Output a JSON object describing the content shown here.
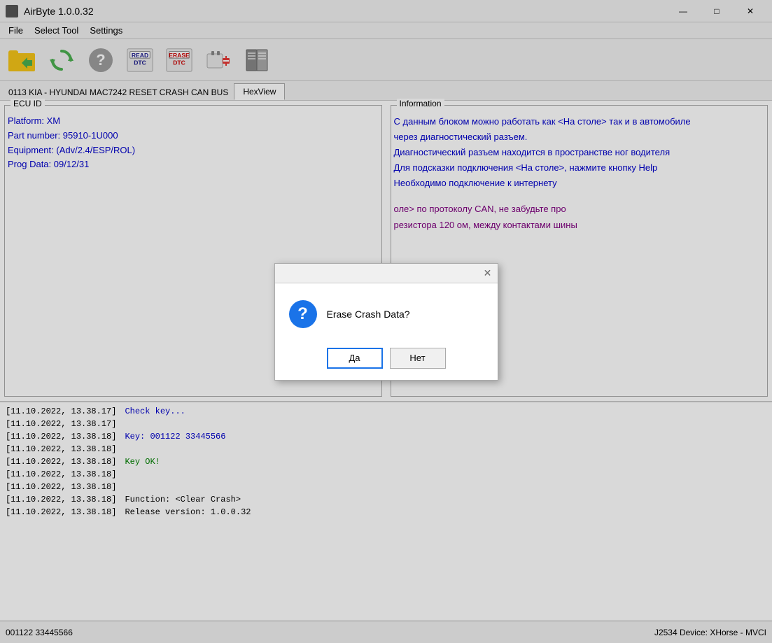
{
  "window": {
    "title": "AirByte  1.0.0.32",
    "controls": {
      "minimize": "—",
      "maximize": "□",
      "close": "✕"
    }
  },
  "menu": {
    "items": [
      "File",
      "Select Tool",
      "Settings"
    ]
  },
  "toolbar": {
    "buttons": [
      {
        "name": "open-file",
        "icon": "folder",
        "label": ""
      },
      {
        "name": "refresh",
        "icon": "refresh",
        "label": ""
      },
      {
        "name": "help",
        "icon": "help",
        "label": ""
      },
      {
        "name": "read-dtc",
        "icon": "read-dtc",
        "label": "READ\nDTC"
      },
      {
        "name": "erase-dtc",
        "icon": "erase-dtc",
        "label": "ERASE\nDTC"
      },
      {
        "name": "plugin",
        "icon": "plugin",
        "label": ""
      },
      {
        "name": "book",
        "icon": "book",
        "label": ""
      }
    ]
  },
  "tabs": {
    "main_label": "0113 KIA - HYUNDAI MAC7242 RESET CRASH CAN BUS",
    "items": [
      {
        "id": "hexview",
        "label": "HexView",
        "active": true
      }
    ]
  },
  "ecu_id": {
    "title": "ECU ID",
    "platform": "Platform: XM",
    "part_number": "Part number: 95910-1U000",
    "equipment": "Equipment: (Adv/2.4/ESP/ROL)",
    "prog_data": "Prog Data: 09/12/31"
  },
  "information": {
    "title": "Information",
    "lines": [
      {
        "text": "С данным блоком можно работать как <На столе> так и в автомобиле через диагностический разъем.",
        "color": "blue"
      },
      {
        "text": "Диагностический разъем находится в пространстве ног водителя",
        "color": "blue"
      },
      {
        "text": "Для подсказки подключения <На столе>, нажмите кнопку Help",
        "color": "blue"
      },
      {
        "text": "Необходимо подключение к интернету",
        "color": "blue"
      },
      {
        "text": "",
        "color": "blue"
      },
      {
        "text": "оле> по протоколу CAN, не забудьте про резистора 120 ом, между контактами шины",
        "color": "purple"
      }
    ]
  },
  "dialog": {
    "message": "Erase Crash Data?",
    "yes_label": "Да",
    "no_label": "Нет"
  },
  "log": {
    "entries": [
      {
        "time": "[11.10.2022, 13.38.17]",
        "message": "Check key...",
        "color": "blue"
      },
      {
        "time": "[11.10.2022, 13.38.17]",
        "message": "",
        "color": "black"
      },
      {
        "time": "[11.10.2022, 13.38.18]",
        "message": "Key: 001122  33445566",
        "color": "blue"
      },
      {
        "time": "[11.10.2022, 13.38.18]",
        "message": "",
        "color": "black"
      },
      {
        "time": "[11.10.2022, 13.38.18]",
        "message": "Key OK!",
        "color": "green"
      },
      {
        "time": "[11.10.2022, 13.38.18]",
        "message": "",
        "color": "black"
      },
      {
        "time": "[11.10.2022, 13.38.18]",
        "message": "",
        "color": "black"
      },
      {
        "time": "[11.10.2022, 13.38.18]",
        "message": "Function: <Clear Crash>",
        "color": "black"
      },
      {
        "time": "[11.10.2022, 13.38.18]",
        "message": "Release version: 1.0.0.32",
        "color": "black"
      }
    ]
  },
  "status_bar": {
    "key": "001122  33445566",
    "device": "J2534 Device: XHorse - MVCI"
  }
}
